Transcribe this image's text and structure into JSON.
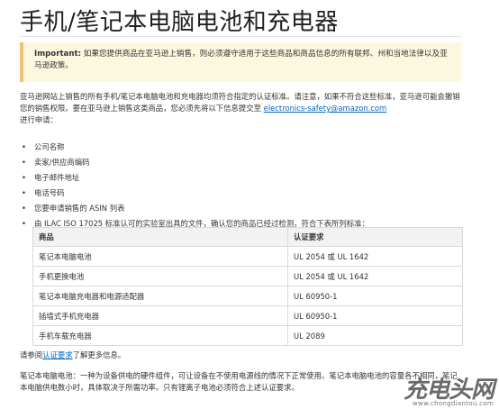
{
  "title": "手机/笔记本电脑电池和充电器",
  "notice": {
    "label": "Important:",
    "text": " 如果您提供商品在亚马逊上销售，则必须遵守适用于这些商品和商品信息的所有联邦、州和当地法律以及亚马逊政策。"
  },
  "intro": {
    "text": "亚马逊网站上销售的所有手机/笔记本电脑电池和充电器均须符合指定的认证标准。请注意，如果不符合这些标准，亚马逊可能会撤销您的销售权限。要在亚马逊上销售这类商品，您必须先将以下信息提交至 ",
    "email": "electronics-safety@amazon.com",
    "suffix": "进行申请："
  },
  "requirements": [
    "公司名称",
    "卖家/供应商编码",
    "电子邮件地址",
    "电话号码",
    "您要申请销售的 ASIN 列表",
    "由 ILAC ISO 17025 标准认可的实验室出具的文件，确认您的商品已经过检测，符合下表所列标准："
  ],
  "table": {
    "headers": [
      "商品",
      "认证要求"
    ],
    "rows": [
      [
        "笔记本电脑电池",
        "UL 2054 或 UL 1642"
      ],
      [
        "手机更换电池",
        "UL 2054 或 UL 1642"
      ],
      [
        "笔记本电脑充电器和电源适配器",
        "UL 60950-1"
      ],
      [
        "插墙式手机充电器",
        "UL 60950-1"
      ],
      [
        "手机车载充电器",
        "UL 2089"
      ]
    ]
  },
  "more_info": {
    "prefix": "请参阅",
    "link": "认证要求",
    "suffix": "了解更多信息。"
  },
  "footer_text": "笔记本电脑电池：一种为设备供电的硬件组件，可让设备在不使用电源线的情况下正常使用。笔记本电脑电池的容量各不相同，笔记本电脑供电数小时，具体取决于所需功率。只有锂离子电池必须符合上述认证要求。",
  "watermark": {
    "main": "充电头网",
    "sub": "www.chongdiantou.com"
  }
}
